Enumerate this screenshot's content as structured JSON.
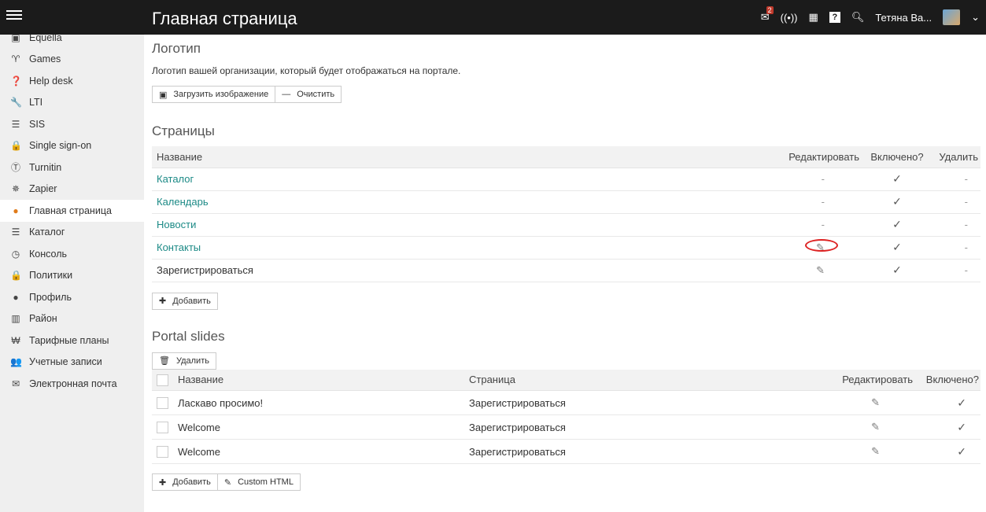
{
  "topbar": {
    "title": "Главная страница",
    "user": "Тетяна Ва...",
    "notif_count": "2"
  },
  "sidebar": {
    "items": [
      {
        "label": "Equella",
        "icon": "equella-icon",
        "glyph": "▣"
      },
      {
        "label": "Games",
        "icon": "trophy-icon",
        "glyph": "♈"
      },
      {
        "label": "Help desk",
        "icon": "help-icon",
        "glyph": "❓"
      },
      {
        "label": "LTI",
        "icon": "wrench-icon",
        "glyph": "🔧"
      },
      {
        "label": "SIS",
        "icon": "database-icon",
        "glyph": "☰"
      },
      {
        "label": "Single sign-on",
        "icon": "lock-icon",
        "glyph": "🔒"
      },
      {
        "label": "Turnitin",
        "icon": "turnitin-icon",
        "glyph": "Ⓣ"
      },
      {
        "label": "Zapier",
        "icon": "zapier-icon",
        "glyph": "✵"
      },
      {
        "label": "Главная страница",
        "icon": "globe-icon",
        "glyph": "●"
      },
      {
        "label": "Каталог",
        "icon": "list-icon",
        "glyph": "☰"
      },
      {
        "label": "Консоль",
        "icon": "console-icon",
        "glyph": "◷"
      },
      {
        "label": "Политики",
        "icon": "lock-icon",
        "glyph": "🔒"
      },
      {
        "label": "Профиль",
        "icon": "info-icon",
        "glyph": "●"
      },
      {
        "label": "Район",
        "icon": "district-icon",
        "glyph": "▥"
      },
      {
        "label": "Тарифные планы",
        "icon": "plans-icon",
        "glyph": "₩"
      },
      {
        "label": "Учетные записи",
        "icon": "users-icon",
        "glyph": "👥"
      },
      {
        "label": "Электронная почта",
        "icon": "mail-icon",
        "glyph": "✉"
      }
    ]
  },
  "logo": {
    "heading": "Логотип",
    "description": "Логотип вашей организации, который будет отображаться на портале.",
    "upload_label": "Загрузить изображение",
    "clear_label": "Очистить"
  },
  "pages": {
    "heading": "Страницы",
    "columns": {
      "name": "Название",
      "edit": "Редактировать",
      "enabled": "Включено?",
      "delete": "Удалить"
    },
    "rows": [
      {
        "name": "Каталог",
        "link": true,
        "edit": "-",
        "enabled": "✓",
        "delete": "-"
      },
      {
        "name": "Календарь",
        "link": true,
        "edit": "-",
        "enabled": "✓",
        "delete": "-"
      },
      {
        "name": "Новости",
        "link": true,
        "edit": "-",
        "enabled": "✓",
        "delete": "-"
      },
      {
        "name": "Контакты",
        "link": true,
        "edit": "pencil",
        "enabled": "✓",
        "delete": "-"
      },
      {
        "name": "Зарегистрироваться",
        "link": false,
        "edit": "pencil",
        "enabled": "✓",
        "delete": "-"
      }
    ],
    "add_label": "Добавить"
  },
  "slides": {
    "heading": "Portal slides",
    "delete_label": "Удалить",
    "columns": {
      "name": "Название",
      "page": "Страница",
      "edit": "Редактировать",
      "enabled": "Включено?"
    },
    "rows": [
      {
        "name": "Ласкаво просимо!",
        "page": "Зарегистрироваться",
        "enabled": "✓"
      },
      {
        "name": "Welcome",
        "page": "Зарегистрироваться",
        "enabled": "✓"
      },
      {
        "name": "Welcome",
        "page": "Зарегистрироваться",
        "enabled": "✓"
      }
    ],
    "add_label": "Добавить",
    "custom_html_label": "Custom HTML"
  },
  "glyphs": {
    "check": "✓",
    "pencil": "✎",
    "dash": "-"
  }
}
